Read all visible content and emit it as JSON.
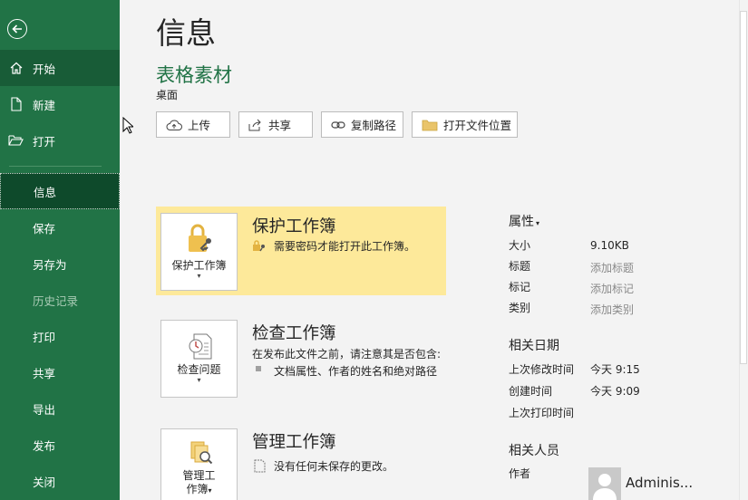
{
  "sidebar": {
    "items": [
      {
        "label": "开始"
      },
      {
        "label": "新建"
      },
      {
        "label": "打开"
      },
      {
        "label": "信息"
      },
      {
        "label": "保存"
      },
      {
        "label": "另存为"
      },
      {
        "label": "历史记录"
      },
      {
        "label": "打印"
      },
      {
        "label": "共享"
      },
      {
        "label": "导出"
      },
      {
        "label": "发布"
      },
      {
        "label": "关闭"
      }
    ]
  },
  "main": {
    "title": "信息",
    "file_name": "表格素材",
    "file_location": "桌面",
    "toolbar": {
      "upload": "上传",
      "share": "共享",
      "copy_path": "复制路径",
      "open_location": "打开文件位置"
    },
    "protect": {
      "button_label": "保护工作簿",
      "title": "保护工作簿",
      "description": "需要密码才能打开此工作簿。"
    },
    "inspect": {
      "button_label": "检查问题",
      "title": "检查工作簿",
      "description": "在发布此文件之前，请注意其是否包含:",
      "bullet": "文档属性、作者的姓名和绝对路径"
    },
    "manage": {
      "button_label_1": "管理工",
      "button_label_2": "作簿",
      "title": "管理工作簿",
      "description": "没有任何未保存的更改。"
    }
  },
  "properties": {
    "heading": "属性",
    "size_label": "大小",
    "size_value": "9.10KB",
    "title_label": "标题",
    "title_placeholder": "添加标题",
    "tags_label": "标记",
    "tags_placeholder": "添加标记",
    "category_label": "类别",
    "category_placeholder": "添加类别",
    "dates_heading": "相关日期",
    "modified_label": "上次修改时间",
    "modified_value": "今天 9:15",
    "created_label": "创建时间",
    "created_value": "今天 9:09",
    "printed_label": "上次打印时间",
    "people_heading": "相关人员",
    "author_label": "作者",
    "author_name": "Adminis..."
  },
  "colors": {
    "sidebar": "#217346",
    "sidebar_selected": "#185c37",
    "accent_green": "#217346",
    "highlight": "#fde99a"
  }
}
